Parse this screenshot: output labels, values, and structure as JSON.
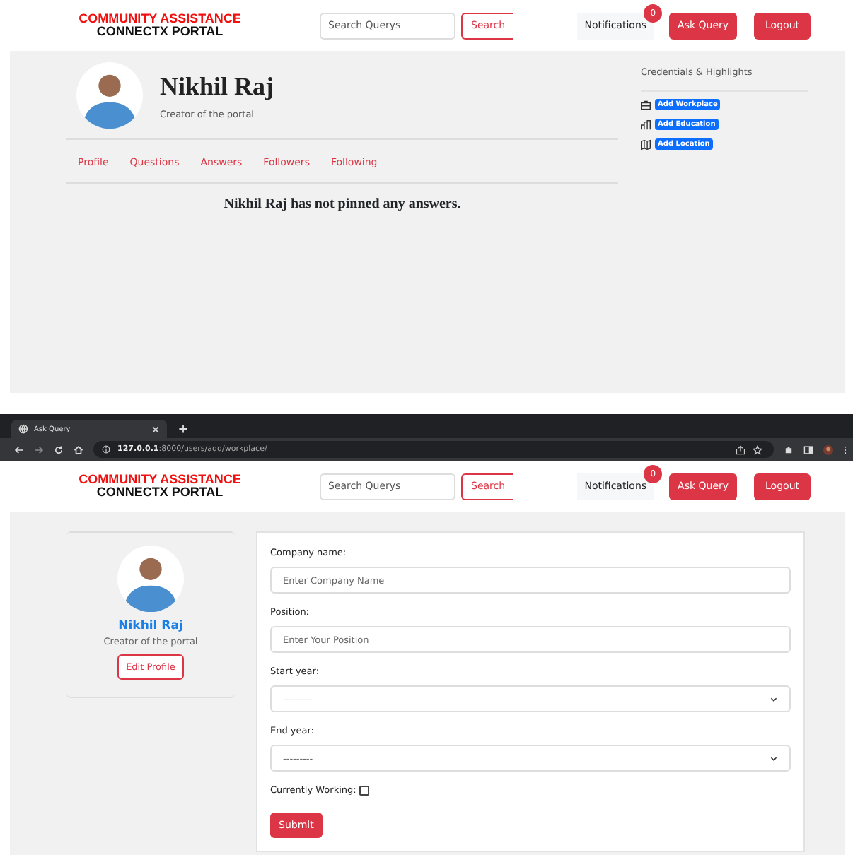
{
  "profile_page": {
    "header": {
      "brand_line_1": "COMMUNITY ASSISTANCE",
      "brand_line_2": "CONNECTX PORTAL",
      "search": {
        "placeholder": "Search Querys"
      },
      "search_button": "Search",
      "notifications": "Notifications",
      "notification_count": "0",
      "ask_button": "Ask Query",
      "logout_button": "Logout"
    },
    "user": {
      "name": "Nikhil Raj",
      "subtitle": "Creator of the portal"
    },
    "tabs": [
      {
        "label": "Profile",
        "selected": false
      },
      {
        "label": "Questions",
        "selected": false
      },
      {
        "label": "Answers",
        "selected": false
      },
      {
        "label": "Followers",
        "selected": false
      },
      {
        "label": "Following",
        "selected": false
      }
    ],
    "empty_message": "Nikhil Raj has not pinned any answers.",
    "credentials": {
      "title": "Credentials & Highlights",
      "items": [
        {
          "kind": "workplace",
          "label": "Add Workplace"
        },
        {
          "kind": "education",
          "label": "Add Education"
        },
        {
          "kind": "location",
          "label": "Add Location"
        }
      ]
    }
  },
  "browser": {
    "tab_title": "Ask Query",
    "address": "**127.0.0.1**:8000/users/add/workplace/"
  },
  "workplace_page": {
    "header": {
      "brand_line_1": "COMMUNITY ASSISTANCE",
      "brand_line_2": "CONNECTX PORTAL",
      "search": {
        "placeholder": "Search Querys"
      },
      "search_button": "Search",
      "notifications": "Notifications",
      "notification_count": "0",
      "ask_button": "Ask Query",
      "logout_button": "Logout"
    },
    "user": {
      "name": "Nikhil Raj",
      "subtitle": "Creator of the portal",
      "edit_button": "Edit Profile"
    },
    "form": {
      "fields": [
        {
          "kind": "text",
          "label": "Company name:",
          "placeholder": "Enter Company Name"
        },
        {
          "kind": "text",
          "label": "Position:",
          "placeholder": "Enter Your Position"
        },
        {
          "kind": "select",
          "label": "Start year:",
          "value": "---------"
        },
        {
          "kind": "select",
          "label": "End year:",
          "value": "---------"
        },
        {
          "kind": "checkbox",
          "label": "Currently Working:",
          "checked": false
        }
      ],
      "submit": "Submit"
    }
  }
}
